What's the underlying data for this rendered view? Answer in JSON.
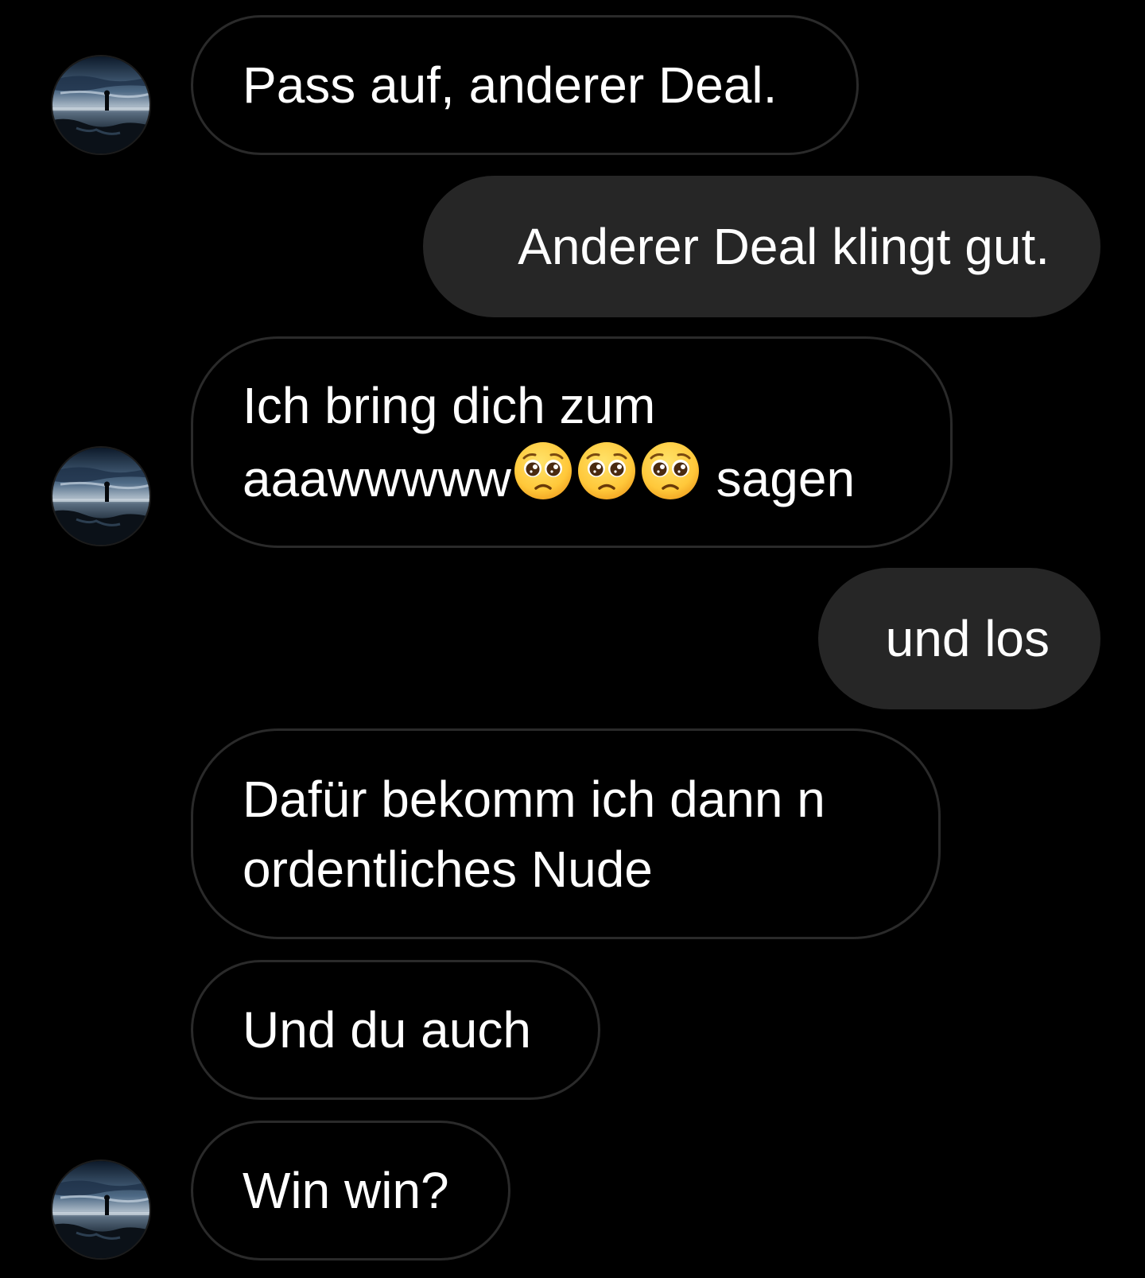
{
  "colors": {
    "background": "#000000",
    "sent_bubble": "#262626",
    "received_border": "#2a2a2a",
    "text": "#ffffff"
  },
  "avatar": {
    "icon": "profile-photo-lake-silhouette"
  },
  "messages": [
    {
      "direction": "received",
      "lines": [
        "Pass auf, anderer Deal."
      ]
    },
    {
      "direction": "sent",
      "lines": [
        "Anderer Deal klingt gut."
      ]
    },
    {
      "direction": "received",
      "lines": [
        "Ich bring dich zum",
        "aaawwwww"
      ],
      "emoji": "pleading-face-emoji",
      "emoji_count": 3,
      "trailing": " sagen"
    },
    {
      "direction": "sent",
      "lines": [
        "und los"
      ]
    },
    {
      "direction": "received",
      "lines": [
        "Dafür bekomm ich dann n",
        "ordentliches Nude"
      ]
    },
    {
      "direction": "received",
      "lines": [
        "Und du auch"
      ]
    },
    {
      "direction": "received",
      "lines": [
        "Win win?"
      ]
    }
  ]
}
